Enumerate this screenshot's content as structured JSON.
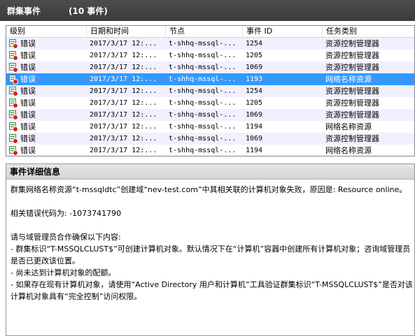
{
  "title": {
    "name": "群集事件",
    "count": "(10 事件)"
  },
  "columns": [
    "级别",
    "日期和时间",
    "节点",
    "事件 ID",
    "任务类别"
  ],
  "rows": [
    {
      "level": "错误",
      "datetime": "2017/3/17 12:...",
      "node": "t-shhq-mssql-...",
      "event_id": "1254",
      "category": "资源控制管理器"
    },
    {
      "level": "错误",
      "datetime": "2017/3/17 12:...",
      "node": "t-shhq-mssql-...",
      "event_id": "1205",
      "category": "资源控制管理器"
    },
    {
      "level": "错误",
      "datetime": "2017/3/17 12:...",
      "node": "t-shhq-mssql-...",
      "event_id": "1069",
      "category": "资源控制管理器"
    },
    {
      "level": "错误",
      "datetime": "2017/3/17 12:...",
      "node": "t-shhq-mssql-...",
      "event_id": "1193",
      "category": "网络名称资源"
    },
    {
      "level": "错误",
      "datetime": "2017/3/17 12:...",
      "node": "t-shhq-mssql-...",
      "event_id": "1254",
      "category": "资源控制管理器"
    },
    {
      "level": "错误",
      "datetime": "2017/3/17 12:...",
      "node": "t-shhq-mssql-...",
      "event_id": "1205",
      "category": "资源控制管理器"
    },
    {
      "level": "错误",
      "datetime": "2017/3/17 12:...",
      "node": "t-shhq-mssql-...",
      "event_id": "1069",
      "category": "资源控制管理器"
    },
    {
      "level": "错误",
      "datetime": "2017/3/17 12:...",
      "node": "t-shhq-mssql-...",
      "event_id": "1194",
      "category": "网络名称资源"
    },
    {
      "level": "错误",
      "datetime": "2017/3/17 12:...",
      "node": "t-shhq-mssql-...",
      "event_id": "1069",
      "category": "资源控制管理器"
    },
    {
      "level": "错误",
      "datetime": "2017/3/17 12:...",
      "node": "t-shhq-mssql-...",
      "event_id": "1194",
      "category": "网络名称资源"
    }
  ],
  "selected_row_index": 3,
  "row_icon": "error-event-icon",
  "colors": {
    "selection": "#3399ff",
    "alt_row": "#f0f0ff",
    "titlebar": "#3f3f3f"
  },
  "details": {
    "header": "事件详细信息",
    "line1": "群集网络名称资源“t-mssqldtc”创建域“nev-test.com”中其相关联的计算机对象失败，原因是: Resource online。",
    "line2": "相关错误代码为: -1073741790",
    "line3": "请与域管理员合作确保以下内容:",
    "line4": "- 群集标识“T-MSSQLCLUST$”可创建计算机对象。默认情况下在“计算机”容器中创建所有计算机对象；咨询域管理员是否已更改该位置。",
    "line5": "- 尚未达到计算机对象的配额。",
    "line6": "- 如果存在现有计算机对象，请使用“Active Directory 用户和计算机”工具验证群集标识“T-MSSQLCLUST$”是否对该计算机对象具有“完全控制”访问权限。"
  }
}
